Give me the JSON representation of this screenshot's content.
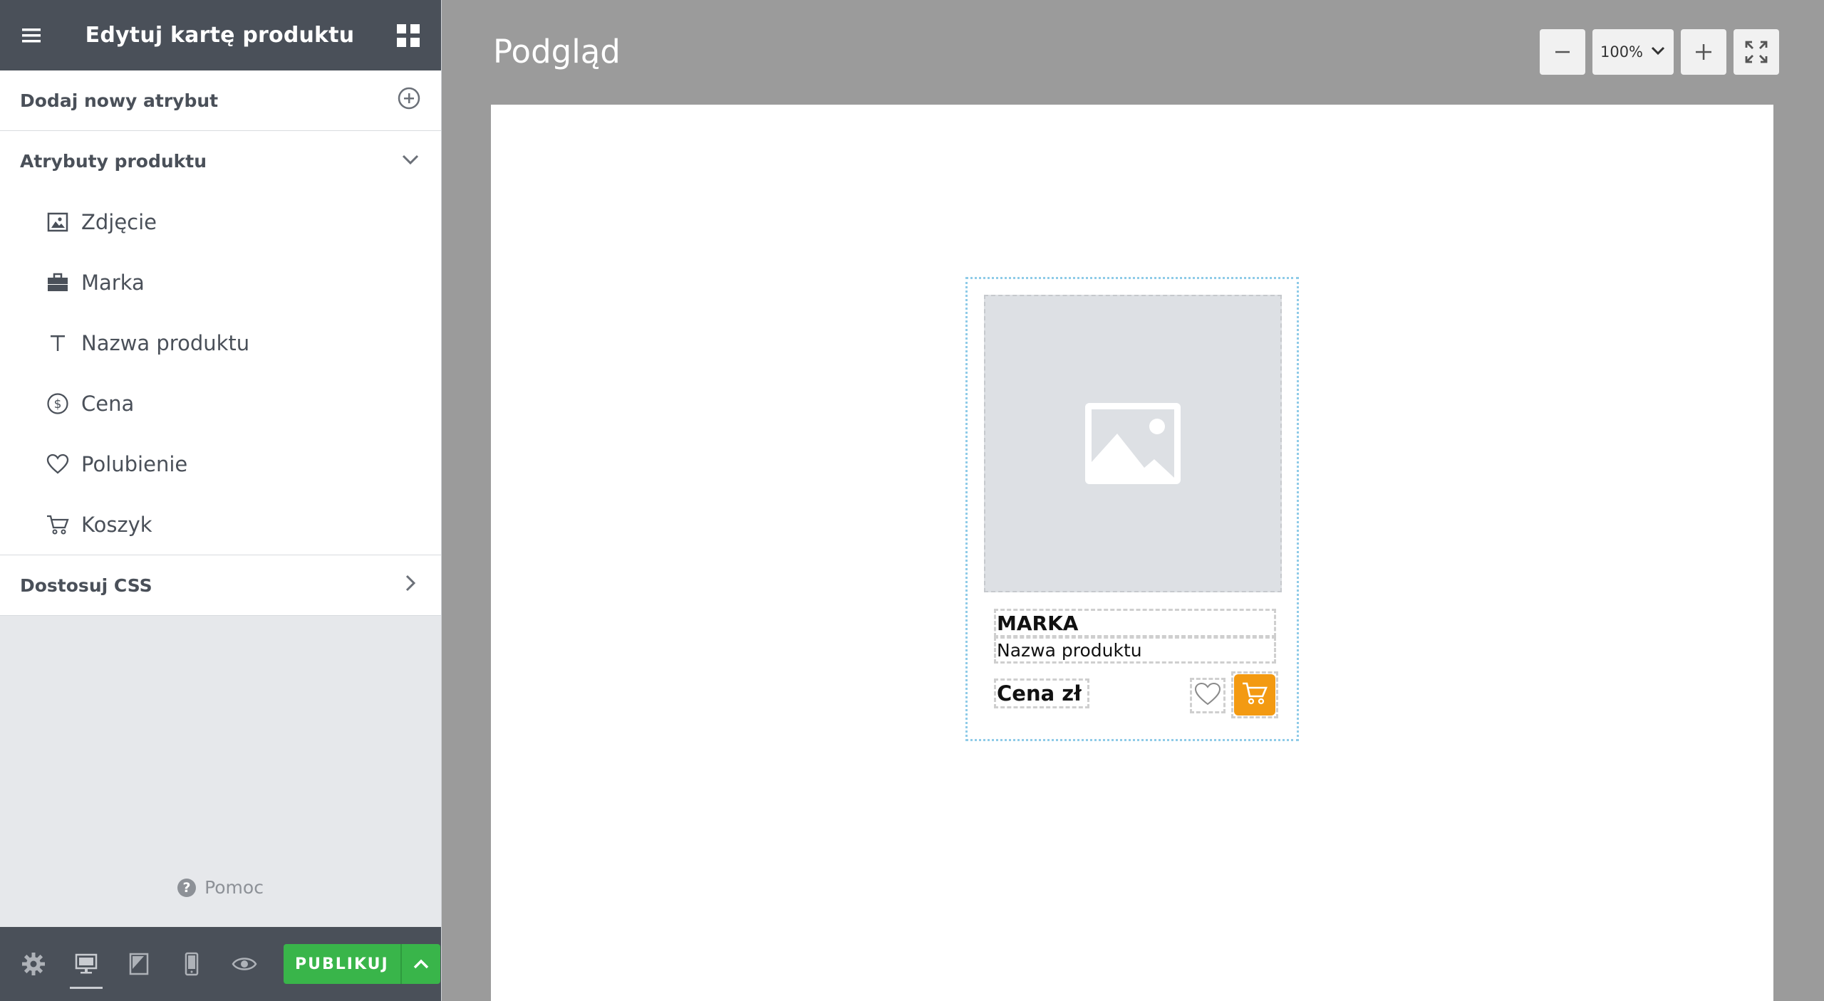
{
  "sidebar": {
    "title": "Edytuj kartę produktu",
    "add_attribute_label": "Dodaj nowy atrybut",
    "attributes_section_label": "Atrybuty produktu",
    "attributes": [
      {
        "label": "Zdjęcie",
        "icon": "image-icon"
      },
      {
        "label": "Marka",
        "icon": "briefcase-icon"
      },
      {
        "label": "Nazwa produktu",
        "icon": "text-icon"
      },
      {
        "label": "Cena",
        "icon": "dollar-circle-icon"
      },
      {
        "label": "Polubienie",
        "icon": "heart-icon"
      },
      {
        "label": "Koszyk",
        "icon": "cart-icon"
      }
    ],
    "css_section_label": "Dostosuj CSS",
    "help_label": "Pomoc",
    "publish_label": "PUBLIKUJ"
  },
  "main": {
    "title": "Podgląd",
    "zoom_value": "100%"
  },
  "preview_card": {
    "brand": "MARKA",
    "product_name": "Nazwa produktu",
    "price": "Cena zł"
  },
  "colors": {
    "header_bg": "#4a5059",
    "publish_green": "#39b54a",
    "cart_orange": "#f39a12",
    "card_outline": "#8fcbe8"
  }
}
